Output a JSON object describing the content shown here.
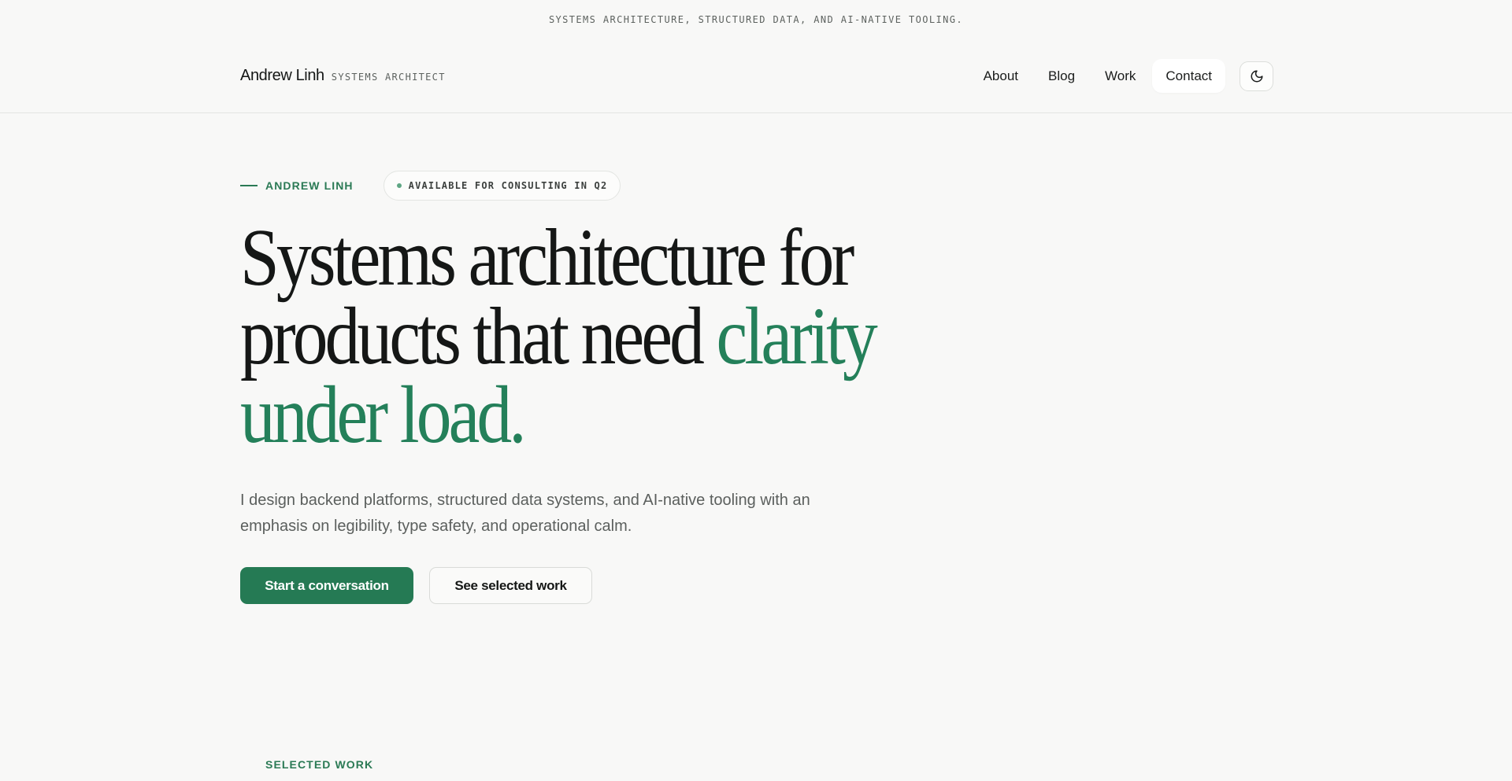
{
  "announcement": "SYSTEMS ARCHITECTURE, STRUCTURED DATA, AND AI-NATIVE TOOLING.",
  "header": {
    "name": "Andrew Linh",
    "tagline": "SYSTEMS ARCHITECT",
    "nav": [
      {
        "label": "About"
      },
      {
        "label": "Blog"
      },
      {
        "label": "Work"
      },
      {
        "label": "Contact",
        "active": true
      }
    ],
    "theme_toggle_icon": "moon-icon"
  },
  "hero": {
    "eyebrow": "ANDREW LINH",
    "badge": "AVAILABLE FOR CONSULTING IN Q2",
    "headline_line1": "Systems architecture for",
    "headline_line2_plain": "products that need ",
    "headline_line2_accent": "clarity",
    "headline_line3_accent": "under load.",
    "lede": "I design backend platforms, structured data systems, and AI-native tooling with an emphasis on legibility, type safety, and operational calm.",
    "primary_cta": "Start a conversation",
    "secondary_cta": "See selected work"
  },
  "next_section_label": "SELECTED WORK",
  "colors": {
    "accent": "#24805a",
    "background": "#f8f8f7",
    "text": "#151716"
  }
}
